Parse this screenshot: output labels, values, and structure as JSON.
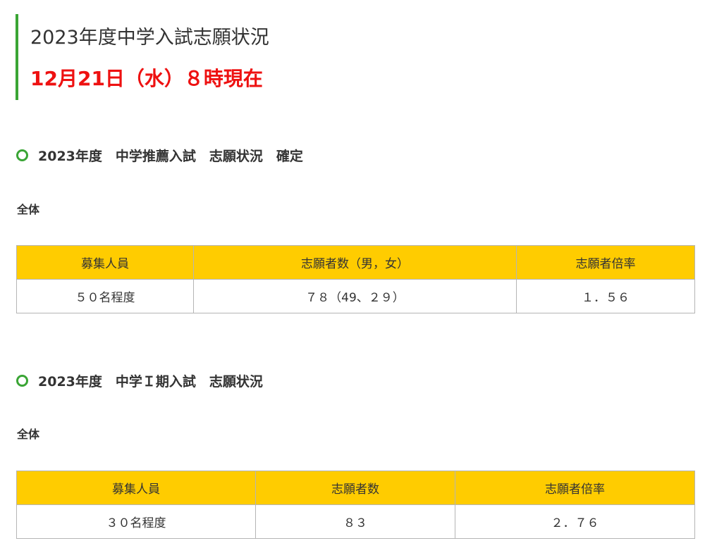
{
  "header": {
    "title": "2023年度中学入試志願状況",
    "update_time": "12月21日（水）８時現在"
  },
  "colors": {
    "accent_green": "#3aa535",
    "highlight_red": "#ee1111",
    "table_header_yellow": "#ffcc00"
  },
  "sections": [
    {
      "heading": "2023年度　中学推薦入試　志願状況　確定",
      "label": "全体",
      "table": {
        "headers": [
          "募集人員",
          "志願者数（男，女）",
          "志願者倍率"
        ],
        "rows": [
          [
            "５０名程度",
            "７８（49、２９）",
            "１．５６"
          ]
        ]
      }
    },
    {
      "heading": "2023年度　中学Ｉ期入試　志願状況",
      "label": "全体",
      "table": {
        "headers": [
          "募集人員",
          "志願者数",
          "志願者倍率"
        ],
        "rows": [
          [
            "３０名程度",
            "８３",
            "２．７６"
          ]
        ]
      }
    }
  ]
}
